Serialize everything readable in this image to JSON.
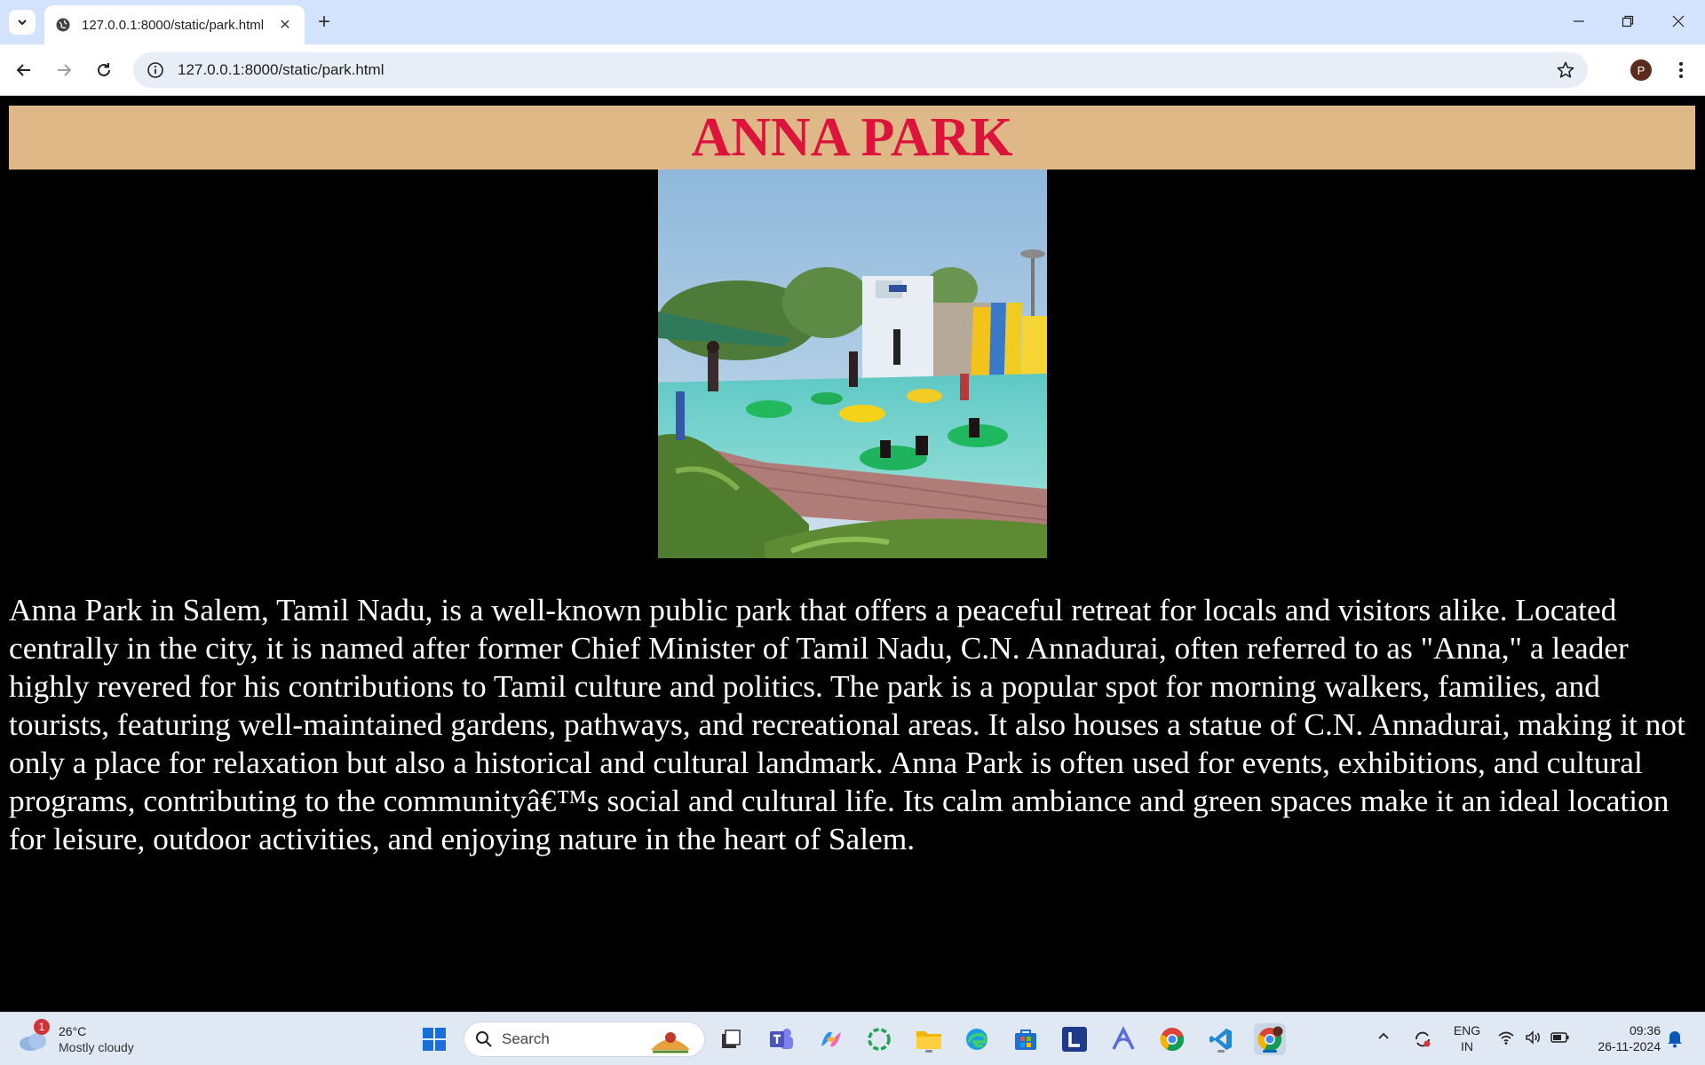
{
  "browser": {
    "tab_title": "127.0.0.1:8000/static/park.html",
    "url": "127.0.0.1:8000/static/park.html",
    "profile_initial": "P"
  },
  "page": {
    "title": "ANNA PARK",
    "description": "Anna Park in Salem, Tamil Nadu, is a well-known public park that offers a peaceful retreat for locals and visitors alike. Located centrally in the city, it is named after former Chief Minister of Tamil Nadu, C.N. Annadurai, often referred to as \"Anna,\" a leader highly revered for his contributions to Tamil culture and politics. The park is a popular spot for morning walkers, families, and tourists, featuring well-maintained gardens, pathways, and recreational areas. It also houses a statue of C.N. Annadurai, making it not only a place for relaxation but also a historical and cultural landmark. Anna Park is often used for events, exhibitions, and cultural programs, contributing to the communityâ€™s social and cultural life. Its calm ambiance and green spaces make it an ideal location for leisure, outdoor activities, and enjoying nature in the heart of Salem.",
    "header_bg": "#deb887",
    "title_color": "#dc143c"
  },
  "taskbar": {
    "weather_temp": "26°C",
    "weather_condition": "Mostly cloudy",
    "weather_badge": "1",
    "search_label": "Search",
    "lang_line1": "ENG",
    "lang_line2": "IN",
    "time": "09:36",
    "date": "26-11-2024",
    "apps": [
      "start-icon",
      "task-view-icon",
      "teams-icon",
      "copilot-icon",
      "circle-app-icon",
      "file-explorer-icon",
      "edge-icon",
      "store-icon",
      "l-app-icon",
      "arc-icon",
      "chrome-icon",
      "vscode-icon",
      "chrome-profile-icon"
    ]
  }
}
